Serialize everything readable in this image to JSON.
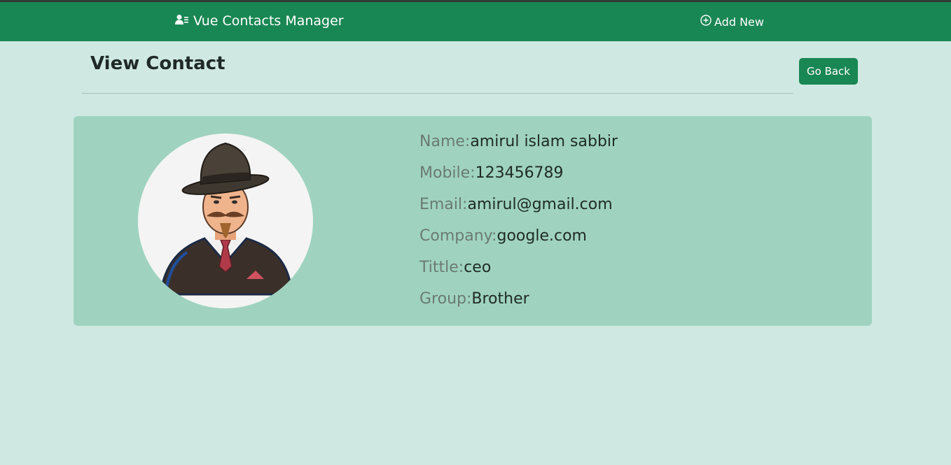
{
  "navbar": {
    "brand_label": "Vue Contacts Manager",
    "brand_icon": "contacts-icon",
    "add_new_label": "Add New",
    "add_new_icon": "plus-circle-icon",
    "color": "#198754"
  },
  "page": {
    "title": "View Contact",
    "go_back_label": "Go Back"
  },
  "contact": {
    "avatar": "man-with-hat-illustration",
    "fields": [
      {
        "label": "Name:",
        "value": "amirul islam sabbir"
      },
      {
        "label": "Mobile:",
        "value": "123456789"
      },
      {
        "label": "Email:",
        "value": "amirul@gmail.com"
      },
      {
        "label": "Company:",
        "value": "google.com"
      },
      {
        "label": "Tittle:",
        "value": "ceo"
      },
      {
        "label": "Group:",
        "value": "Brother"
      }
    ]
  },
  "colors": {
    "background": "#cfe9e2",
    "card": "#9fd3c0",
    "accent": "#198754"
  }
}
